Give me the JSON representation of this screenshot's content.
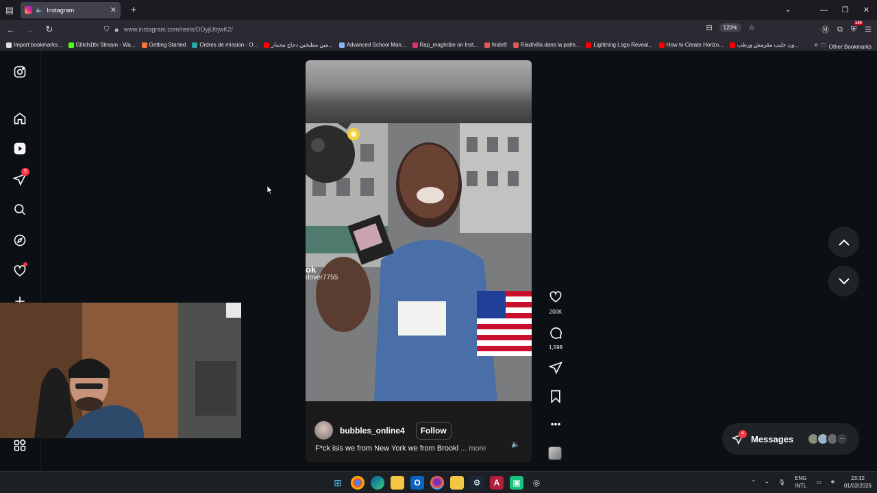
{
  "browser": {
    "tab_title": "Instagram",
    "url": "www.instagram.com/reels/DOyjUtrjwK2/",
    "zoom": "120%",
    "ext_badge": "140",
    "bookmarks": [
      {
        "label": "Import bookmarks...",
        "color": "#e0e0e0"
      },
      {
        "label": "Glitch1ttv Stream - Wa...",
        "color": "#53fc18"
      },
      {
        "label": "Getting Started",
        "color": "#ff7139"
      },
      {
        "label": "Ordres de mission - O...",
        "color": "#28a8a8"
      },
      {
        "label": "مين مطبخين دجاج محمار...",
        "color": "#ff0000"
      },
      {
        "label": "Advanced School Man...",
        "color": "#8ab4f8"
      },
      {
        "label": "Rap_maghribe on Inst...",
        "color": "#e1306c"
      },
      {
        "label": "fnide9",
        "color": "#e25a5a"
      },
      {
        "label": "Riad/villa dans la palm...",
        "color": "#e25a5a"
      },
      {
        "label": "Lightning Logo Reveal...",
        "color": "#ff0000"
      },
      {
        "label": "How to Create Horizo...",
        "color": "#ff0000"
      },
      {
        "label": "ون حليب مقرمش ورطب...",
        "color": "#ff0000"
      }
    ],
    "other_bookmarks": "Other Bookmarks"
  },
  "instagram": {
    "notifications_badge": "5",
    "reel": {
      "watermark_main": "ok",
      "watermark_handle": "dover7755",
      "username": "bubbles_online4",
      "follow_label": "Follow",
      "caption": "F*ck isis we from New York we from Brookl",
      "caption_more": "... more"
    },
    "actions": {
      "likes": "200K",
      "comments": "1,598"
    },
    "messages": {
      "label": "Messages",
      "badge": "4"
    }
  },
  "taskbar": {
    "lang_top": "ENG",
    "lang_bottom": "INTL",
    "time": "23:32",
    "date": "01/03/2026"
  }
}
